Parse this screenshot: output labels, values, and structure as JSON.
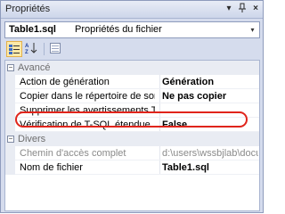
{
  "window": {
    "title": "Propriétés"
  },
  "titlebar_buttons": {
    "dropdown": "▾",
    "pin": "📌",
    "close": "×"
  },
  "selector": {
    "name": "Table1.sql",
    "type": "Propriétés du fichier",
    "arrow": "▾"
  },
  "toolbar": {
    "categorized": "categorized-icon",
    "alphabetical": "alphabetical-sort-icon",
    "property_pages": "property-pages-icon"
  },
  "grid": {
    "categories": [
      {
        "label": "Avancé",
        "expander": "⊟",
        "properties": [
          {
            "name": "Action de génération",
            "value": "Génération",
            "bold": true
          },
          {
            "name": "Copier dans le répertoire de sortie",
            "value": "Ne pas copier",
            "bold": true
          },
          {
            "name": "Supprimer les avertissements TSql",
            "value": "",
            "bold": false
          },
          {
            "name": "Vérification de T-SQL étendue",
            "value": "False",
            "bold": true,
            "highlighted": true
          }
        ]
      },
      {
        "label": "Divers",
        "expander": "⊟",
        "properties": [
          {
            "name": "Chemin d'accès complet",
            "value": "d:\\users\\wssbjlab\\documer",
            "bold": false,
            "dimmed": true
          },
          {
            "name": "Nom de fichier",
            "value": "Table1.sql",
            "bold": true
          }
        ]
      }
    ]
  },
  "colors": {
    "highlight_ring": "#e0241b",
    "window_bg": "#d5dced",
    "category_bg": "#e9ecf3"
  }
}
